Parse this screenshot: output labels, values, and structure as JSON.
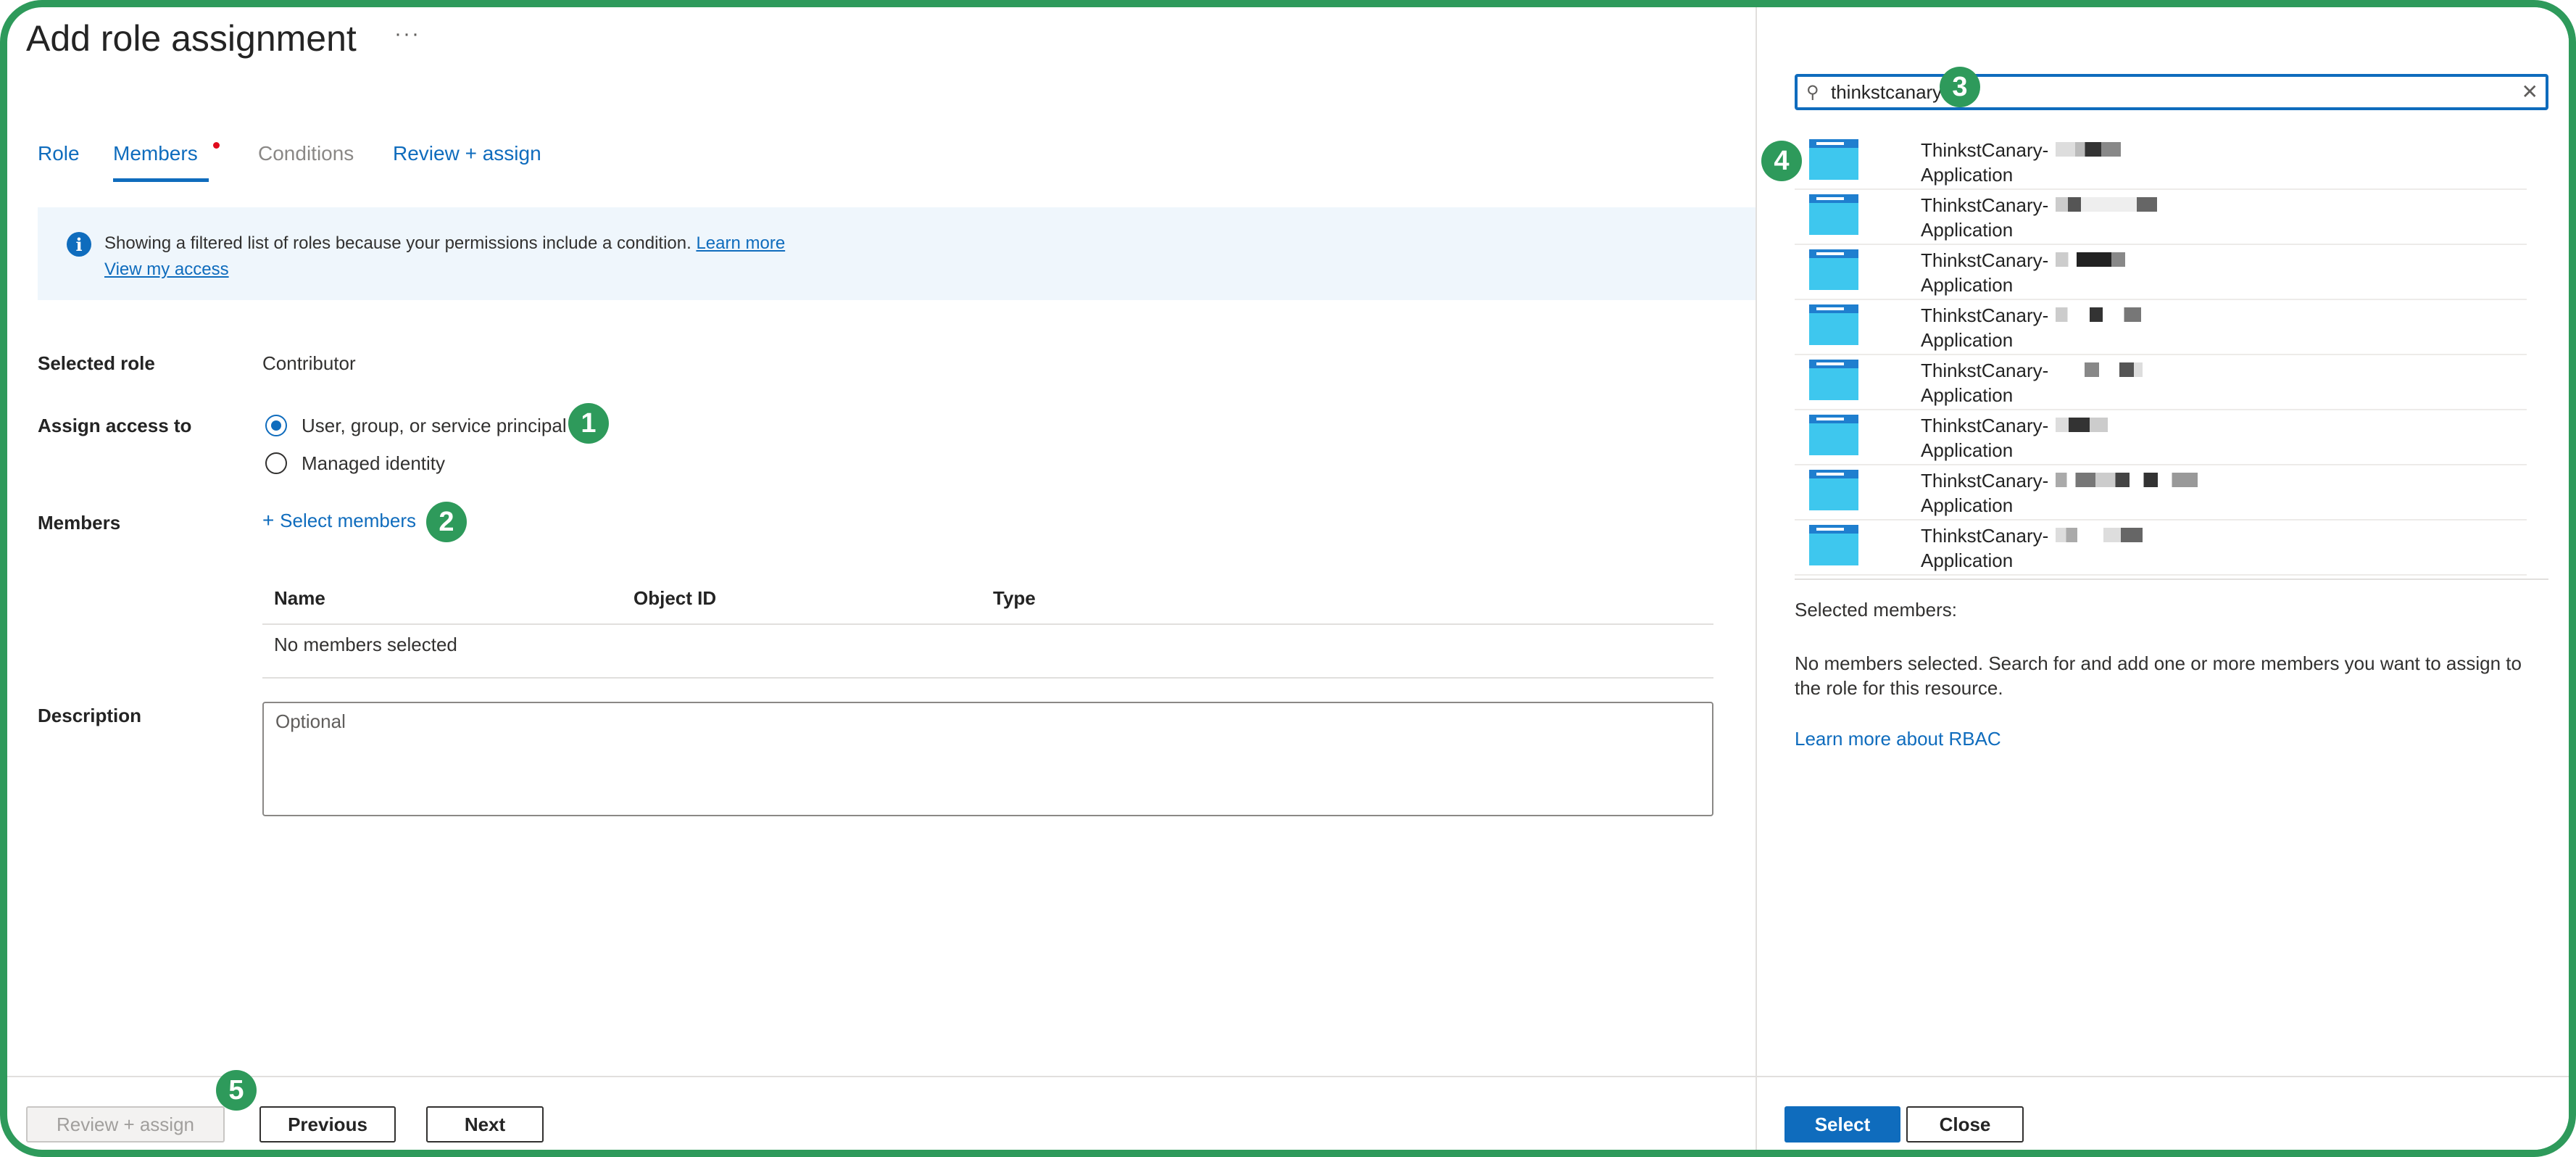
{
  "page": {
    "title": "Add role assignment",
    "more": "···"
  },
  "tabs": [
    {
      "label": "Role",
      "state": "link"
    },
    {
      "label": "Members",
      "state": "active"
    },
    {
      "label": "Conditions",
      "state": "disabled"
    },
    {
      "label": "Review + assign",
      "state": "link"
    }
  ],
  "info": {
    "text": "Showing a filtered list of roles because your permissions include a condition.",
    "learn_more": "Learn more",
    "view_access": "View my access"
  },
  "form": {
    "selected_role_label": "Selected role",
    "selected_role_value": "Contributor",
    "assign_label": "Assign access to",
    "assign_options": [
      "User, group, or service principal",
      "Managed identity"
    ],
    "assign_selected": 0,
    "members_label": "Members",
    "select_members": "Select members",
    "table_headers": [
      "Name",
      "Object ID",
      "Type"
    ],
    "table_empty": "No members selected",
    "description_label": "Description",
    "description_placeholder": "Optional"
  },
  "footer": {
    "review_assign": "Review + assign",
    "previous": "Previous",
    "next": "Next"
  },
  "panel": {
    "search_value": "thinkstcanary",
    "results": [
      {
        "name": "ThinkstCanary-",
        "type": "Application"
      },
      {
        "name": "ThinkstCanary-",
        "type": "Application"
      },
      {
        "name": "ThinkstCanary-",
        "type": "Application"
      },
      {
        "name": "ThinkstCanary-",
        "type": "Application"
      },
      {
        "name": "ThinkstCanary-",
        "type": "Application"
      },
      {
        "name": "ThinkstCanary-",
        "type": "Application"
      },
      {
        "name": "ThinkstCanary-",
        "type": "Application"
      },
      {
        "name": "ThinkstCanary-",
        "type": "Application"
      }
    ],
    "selected_members_label": "Selected members:",
    "no_members_text_1": "No members selected. Search for and add one or more members you want to assign to",
    "no_members_text_2": "the role for this resource.",
    "learn_rbac": "Learn more about RBAC",
    "select_button": "Select",
    "close_button": "Close"
  },
  "callouts": [
    "1",
    "2",
    "3",
    "4",
    "5"
  ],
  "colors": {
    "accent": "#0f6cbd",
    "callout": "#2e9a5b",
    "frame": "#2e9a5b",
    "info_bg": "#eff6fc"
  }
}
